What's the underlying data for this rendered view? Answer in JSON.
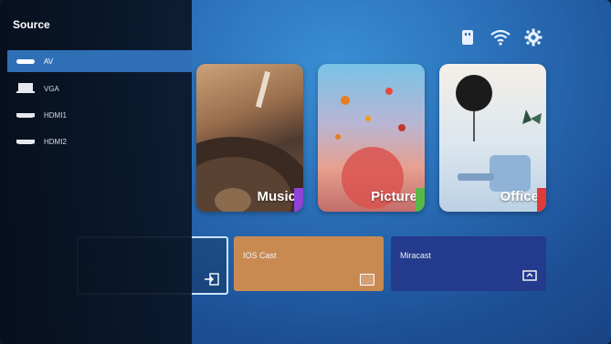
{
  "panel": {
    "title": "Source",
    "items": [
      {
        "label": "AV",
        "icon": "av-icon",
        "selected": true
      },
      {
        "label": "VGA",
        "icon": "vga-monitor-icon",
        "selected": false
      },
      {
        "label": "HDMI1",
        "icon": "hdmi-icon",
        "selected": false
      },
      {
        "label": "HDMI2",
        "icon": "hdmi-icon",
        "selected": false
      }
    ]
  },
  "status_icons": [
    "usb-icon",
    "wifi-icon",
    "settings-gear-icon"
  ],
  "tiles": [
    {
      "label": "Music",
      "accent": "#8e44d6"
    },
    {
      "label": "Picture",
      "accent": "#58b848"
    },
    {
      "label": "Office",
      "accent": "#e03a3a"
    }
  ],
  "bottom_tiles": [
    {
      "label": "",
      "icon": "input-icon"
    },
    {
      "label": "IOS Cast",
      "icon": "cast-icon"
    },
    {
      "label": "Miracast",
      "icon": "screen-mirror-icon"
    }
  ],
  "colors": {
    "panel_selected": "#2f6fb6",
    "ios_cast": "#c98a52",
    "miracast": "#243a8c",
    "background": "#2a6fb8"
  }
}
